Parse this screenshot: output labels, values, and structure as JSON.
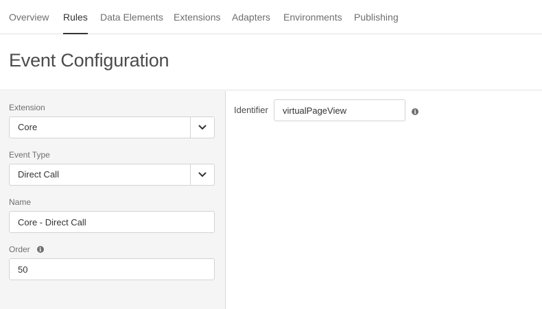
{
  "nav": {
    "tabs": [
      {
        "label": "Overview"
      },
      {
        "label": "Rules"
      },
      {
        "label": "Data Elements"
      },
      {
        "label": "Extensions"
      },
      {
        "label": "Adapters"
      },
      {
        "label": "Environments"
      },
      {
        "label": "Publishing"
      }
    ],
    "active_tab": "Rules"
  },
  "header": {
    "title": "Event Configuration"
  },
  "form": {
    "extension": {
      "label": "Extension",
      "value": "Core"
    },
    "event_type": {
      "label": "Event Type",
      "value": "Direct Call"
    },
    "name": {
      "label": "Name",
      "value": "Core - Direct Call"
    },
    "order": {
      "label": "Order",
      "value": "50"
    }
  },
  "settings": {
    "identifier": {
      "label": "Identifier",
      "value": "virtualPageView"
    }
  },
  "icons": {
    "dropdown": "chevron-down-icon",
    "info": "info-icon"
  },
  "colors": {
    "active_tab_underline": "#323232",
    "left_panel_bg": "#f5f5f5",
    "border": "#d3d3d3"
  }
}
